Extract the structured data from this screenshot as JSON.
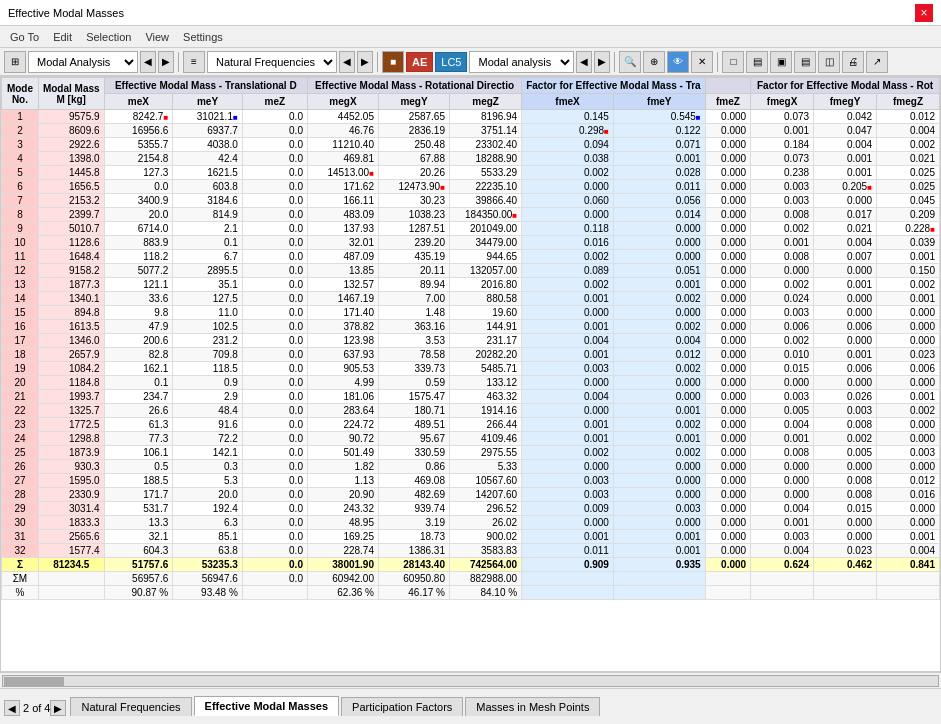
{
  "titleBar": {
    "title": "Effective Modal Masses",
    "closeLabel": "×"
  },
  "menuBar": {
    "items": [
      "Go To",
      "Edit",
      "Selection",
      "View",
      "Settings"
    ]
  },
  "toolbar1": {
    "modalAnalysis": "Modal Analysis",
    "naturalFrequencies": "Natural Frequencies",
    "ae": "AE",
    "lc5": "LC5",
    "modalAnalysisDropdown": "Modal analysis"
  },
  "tableHeaders": {
    "modeNo": "Mode No.",
    "modalMass": "Modal Mass M [kg]",
    "translational": "Effective Modal Mass - Translational D",
    "me_x": "meX",
    "me_y": "meY",
    "me_z": "meZ",
    "rotational": "Effective Modal Mass - Rotational Directi",
    "meg_x": "megX",
    "meg_y": "megY",
    "meg_z": "megZ",
    "factorTrans": "Factor for Effective Modal Mass - Tra",
    "fme_x": "fmeX",
    "fme_y": "fmeY",
    "factorRot": "Factor for Effective Modal Mass - Rot",
    "fme_z": "fmeZ",
    "fmeg_x": "fmegX",
    "fmeg_y": "fmegY",
    "fmeg_z": "fmegZ"
  },
  "rows": [
    {
      "mode": "1",
      "mass": "9575.9",
      "mex": "8242.7",
      "mey": "31021.1",
      "mez": "0.0",
      "megx": "4452.05",
      "megy": "2587.65",
      "megz": "8196.94",
      "fmex": "0.145",
      "fmey": "0.545",
      "fmez": "0.000",
      "fmegx": "0.073",
      "fmegy": "0.042",
      "fmegz": "0.012"
    },
    {
      "mode": "2",
      "mass": "8609.6",
      "mex": "16956.6",
      "mey": "6937.7",
      "mez": "0.0",
      "megx": "46.76",
      "megy": "2836.19",
      "megz": "3751.14",
      "fmex": "0.298",
      "fmey": "0.122",
      "fmez": "0.000",
      "fmegx": "0.001",
      "fmegy": "0.047",
      "fmegz": "0.004"
    },
    {
      "mode": "3",
      "mass": "2922.6",
      "mex": "5355.7",
      "mey": "4038.0",
      "mez": "0.0",
      "megx": "11210.40",
      "megy": "250.48",
      "megz": "23302.40",
      "fmex": "0.094",
      "fmey": "0.071",
      "fmez": "0.000",
      "fmegx": "0.184",
      "fmegy": "0.004",
      "fmegz": "0.002"
    },
    {
      "mode": "4",
      "mass": "1398.0",
      "mex": "2154.8",
      "mey": "42.4",
      "mez": "0.0",
      "megx": "469.81",
      "megy": "67.88",
      "megz": "18288.90",
      "fmex": "0.038",
      "fmey": "0.001",
      "fmez": "0.000",
      "fmegx": "0.073",
      "fmegy": "0.001",
      "fmegz": "0.021"
    },
    {
      "mode": "5",
      "mass": "1445.8",
      "mex": "127.3",
      "mey": "1621.5",
      "mez": "0.0",
      "megx": "14513.00",
      "megy": "20.26",
      "megz": "5533.29",
      "fmex": "0.002",
      "fmey": "0.028",
      "fmez": "0.000",
      "fmegx": "0.238",
      "fmegy": "0.001",
      "fmegz": "0.025"
    },
    {
      "mode": "6",
      "mass": "1656.5",
      "mex": "0.0",
      "mey": "603.8",
      "mez": "0.0",
      "megx": "171.62",
      "megy": "12473.90",
      "megz": "22235.10",
      "fmex": "0.000",
      "fmey": "0.011",
      "fmez": "0.000",
      "fmegx": "0.003",
      "fmegy": "0.205",
      "fmegz": "0.025"
    },
    {
      "mode": "7",
      "mass": "2153.2",
      "mex": "3400.9",
      "mey": "3184.6",
      "mez": "0.0",
      "megx": "166.11",
      "megy": "30.23",
      "megz": "39866.40",
      "fmex": "0.060",
      "fmey": "0.056",
      "fmez": "0.000",
      "fmegx": "0.003",
      "fmegy": "0.000",
      "fmegz": "0.045"
    },
    {
      "mode": "8",
      "mass": "2399.7",
      "mex": "20.0",
      "mey": "814.9",
      "mez": "0.0",
      "megx": "483.09",
      "megy": "1038.23",
      "megz": "184350.00",
      "fmex": "0.000",
      "fmey": "0.014",
      "fmez": "0.000",
      "fmegx": "0.008",
      "fmegy": "0.017",
      "fmegz": "0.209"
    },
    {
      "mode": "9",
      "mass": "5010.7",
      "mex": "6714.0",
      "mey": "2.1",
      "mez": "0.0",
      "megx": "137.93",
      "megy": "1287.51",
      "megz": "201049.00",
      "fmex": "0.118",
      "fmey": "0.000",
      "fmez": "0.000",
      "fmegx": "0.002",
      "fmegy": "0.021",
      "fmegz": "0.228"
    },
    {
      "mode": "10",
      "mass": "1128.6",
      "mex": "883.9",
      "mey": "0.1",
      "mez": "0.0",
      "megx": "32.01",
      "megy": "239.20",
      "megz": "34479.00",
      "fmex": "0.016",
      "fmey": "0.000",
      "fmez": "0.000",
      "fmegx": "0.001",
      "fmegy": "0.004",
      "fmegz": "0.039"
    },
    {
      "mode": "11",
      "mass": "1648.4",
      "mex": "118.2",
      "mey": "6.7",
      "mez": "0.0",
      "megx": "487.09",
      "megy": "435.19",
      "megz": "944.65",
      "fmex": "0.002",
      "fmey": "0.000",
      "fmez": "0.000",
      "fmegx": "0.008",
      "fmegy": "0.007",
      "fmegz": "0.001"
    },
    {
      "mode": "12",
      "mass": "9158.2",
      "mex": "5077.2",
      "mey": "2895.5",
      "mez": "0.0",
      "megx": "13.85",
      "megy": "20.11",
      "megz": "132057.00",
      "fmex": "0.089",
      "fmey": "0.051",
      "fmez": "0.000",
      "fmegx": "0.000",
      "fmegy": "0.000",
      "fmegz": "0.150"
    },
    {
      "mode": "13",
      "mass": "1877.3",
      "mex": "121.1",
      "mey": "35.1",
      "mez": "0.0",
      "megx": "132.57",
      "megy": "89.94",
      "megz": "2016.80",
      "fmex": "0.002",
      "fmey": "0.001",
      "fmez": "0.000",
      "fmegx": "0.002",
      "fmegy": "0.001",
      "fmegz": "0.002"
    },
    {
      "mode": "14",
      "mass": "1340.1",
      "mex": "33.6",
      "mey": "127.5",
      "mez": "0.0",
      "megx": "1467.19",
      "megy": "7.00",
      "megz": "880.58",
      "fmex": "0.001",
      "fmey": "0.002",
      "fmez": "0.000",
      "fmegx": "0.024",
      "fmegy": "0.000",
      "fmegz": "0.001"
    },
    {
      "mode": "15",
      "mass": "894.8",
      "mex": "9.8",
      "mey": "11.0",
      "mez": "0.0",
      "megx": "171.40",
      "megy": "1.48",
      "megz": "19.60",
      "fmex": "0.000",
      "fmey": "0.000",
      "fmez": "0.000",
      "fmegx": "0.003",
      "fmegy": "0.000",
      "fmegz": "0.000"
    },
    {
      "mode": "16",
      "mass": "1613.5",
      "mex": "47.9",
      "mey": "102.5",
      "mez": "0.0",
      "megx": "378.82",
      "megy": "363.16",
      "megz": "144.91",
      "fmex": "0.001",
      "fmey": "0.002",
      "fmez": "0.000",
      "fmegx": "0.006",
      "fmegy": "0.006",
      "fmegz": "0.000"
    },
    {
      "mode": "17",
      "mass": "1346.0",
      "mex": "200.6",
      "mey": "231.2",
      "mez": "0.0",
      "megx": "123.98",
      "megy": "3.53",
      "megz": "231.17",
      "fmex": "0.004",
      "fmey": "0.004",
      "fmez": "0.000",
      "fmegx": "0.002",
      "fmegy": "0.000",
      "fmegz": "0.000"
    },
    {
      "mode": "18",
      "mass": "2657.9",
      "mex": "82.8",
      "mey": "709.8",
      "mez": "0.0",
      "megx": "637.93",
      "megy": "78.58",
      "megz": "20282.20",
      "fmex": "0.001",
      "fmey": "0.012",
      "fmez": "0.000",
      "fmegx": "0.010",
      "fmegy": "0.001",
      "fmegz": "0.023"
    },
    {
      "mode": "19",
      "mass": "1084.2",
      "mex": "162.1",
      "mey": "118.5",
      "mez": "0.0",
      "megx": "905.53",
      "megy": "339.73",
      "megz": "5485.71",
      "fmex": "0.003",
      "fmey": "0.002",
      "fmez": "0.000",
      "fmegx": "0.015",
      "fmegy": "0.006",
      "fmegz": "0.006"
    },
    {
      "mode": "20",
      "mass": "1184.8",
      "mex": "0.1",
      "mey": "0.9",
      "mez": "0.0",
      "megx": "4.99",
      "megy": "0.59",
      "megz": "133.12",
      "fmex": "0.000",
      "fmey": "0.000",
      "fmez": "0.000",
      "fmegx": "0.000",
      "fmegy": "0.000",
      "fmegz": "0.000"
    },
    {
      "mode": "21",
      "mass": "1993.7",
      "mex": "234.7",
      "mey": "2.9",
      "mez": "0.0",
      "megx": "181.06",
      "megy": "1575.47",
      "megz": "463.32",
      "fmex": "0.004",
      "fmey": "0.000",
      "fmez": "0.000",
      "fmegx": "0.003",
      "fmegy": "0.026",
      "fmegz": "0.001"
    },
    {
      "mode": "22",
      "mass": "1325.7",
      "mex": "26.6",
      "mey": "48.4",
      "mez": "0.0",
      "megx": "283.64",
      "megy": "180.71",
      "megz": "1914.16",
      "fmex": "0.000",
      "fmey": "0.001",
      "fmez": "0.000",
      "fmegx": "0.005",
      "fmegy": "0.003",
      "fmegz": "0.002"
    },
    {
      "mode": "23",
      "mass": "1772.5",
      "mex": "61.3",
      "mey": "91.6",
      "mez": "0.0",
      "megx": "224.72",
      "megy": "489.51",
      "megz": "266.44",
      "fmex": "0.001",
      "fmey": "0.002",
      "fmez": "0.000",
      "fmegx": "0.004",
      "fmegy": "0.008",
      "fmegz": "0.000"
    },
    {
      "mode": "24",
      "mass": "1298.8",
      "mex": "77.3",
      "mey": "72.2",
      "mez": "0.0",
      "megx": "90.72",
      "megy": "95.67",
      "megz": "4109.46",
      "fmex": "0.001",
      "fmey": "0.001",
      "fmez": "0.000",
      "fmegx": "0.001",
      "fmegy": "0.002",
      "fmegz": "0.000"
    },
    {
      "mode": "25",
      "mass": "1873.9",
      "mex": "106.1",
      "mey": "142.1",
      "mez": "0.0",
      "megx": "501.49",
      "megy": "330.59",
      "megz": "2975.55",
      "fmex": "0.002",
      "fmey": "0.002",
      "fmez": "0.000",
      "fmegx": "0.008",
      "fmegy": "0.005",
      "fmegz": "0.003"
    },
    {
      "mode": "26",
      "mass": "930.3",
      "mex": "0.5",
      "mey": "0.3",
      "mez": "0.0",
      "megx": "1.82",
      "megy": "0.86",
      "megz": "5.33",
      "fmex": "0.000",
      "fmey": "0.000",
      "fmez": "0.000",
      "fmegx": "0.000",
      "fmegy": "0.000",
      "fmegz": "0.000"
    },
    {
      "mode": "27",
      "mass": "1595.0",
      "mex": "188.5",
      "mey": "5.3",
      "mez": "0.0",
      "megx": "1.13",
      "megy": "469.08",
      "megz": "10567.60",
      "fmex": "0.003",
      "fmey": "0.000",
      "fmez": "0.000",
      "fmegx": "0.000",
      "fmegy": "0.008",
      "fmegz": "0.012"
    },
    {
      "mode": "28",
      "mass": "2330.9",
      "mex": "171.7",
      "mey": "20.0",
      "mez": "0.0",
      "megx": "20.90",
      "megy": "482.69",
      "megz": "14207.60",
      "fmex": "0.003",
      "fmey": "0.000",
      "fmez": "0.000",
      "fmegx": "0.000",
      "fmegy": "0.008",
      "fmegz": "0.016"
    },
    {
      "mode": "29",
      "mass": "3031.4",
      "mex": "531.7",
      "mey": "192.4",
      "mez": "0.0",
      "megx": "243.32",
      "megy": "939.74",
      "megz": "296.52",
      "fmex": "0.009",
      "fmey": "0.003",
      "fmez": "0.000",
      "fmegx": "0.004",
      "fmegy": "0.015",
      "fmegz": "0.000"
    },
    {
      "mode": "30",
      "mass": "1833.3",
      "mex": "13.3",
      "mey": "6.3",
      "mez": "0.0",
      "megx": "48.95",
      "megy": "3.19",
      "megz": "26.02",
      "fmex": "0.000",
      "fmey": "0.000",
      "fmez": "0.000",
      "fmegx": "0.001",
      "fmegy": "0.000",
      "fmegz": "0.000"
    },
    {
      "mode": "31",
      "mass": "2565.6",
      "mex": "32.1",
      "mey": "85.1",
      "mez": "0.0",
      "megx": "169.25",
      "megy": "18.73",
      "megz": "900.02",
      "fmex": "0.001",
      "fmey": "0.001",
      "fmez": "0.000",
      "fmegx": "0.003",
      "fmegy": "0.000",
      "fmegz": "0.001"
    },
    {
      "mode": "32",
      "mass": "1577.4",
      "mex": "604.3",
      "mey": "63.8",
      "mez": "0.0",
      "megx": "228.74",
      "megy": "1386.31",
      "megz": "3583.83",
      "fmex": "0.011",
      "fmey": "0.001",
      "fmez": "0.000",
      "fmegx": "0.004",
      "fmegy": "0.023",
      "fmegz": "0.004"
    }
  ],
  "sumRow": {
    "label": "Σ",
    "mass": "81234.5",
    "mex": "51757.6",
    "mey": "53235.3",
    "mez": "0.0",
    "megx": "38001.90",
    "megy": "28143.40",
    "megz": "742564.00",
    "fmex": "0.909",
    "fmey": "0.935",
    "fmez": "0.000",
    "fmegx": "0.624",
    "fmegy": "0.462",
    "fmegz": "0.841"
  },
  "sumMRow": {
    "label": "ΣM",
    "mex": "56957.6",
    "mey": "56947.6",
    "mez": "0.0",
    "megx": "60942.00",
    "megy": "60950.80",
    "megz": "882988.00"
  },
  "percentRow": {
    "label": "%",
    "mex": "90.87 %",
    "mey": "93.48 %",
    "mez": "",
    "megx": "62.36 %",
    "megy": "46.17 %",
    "megz": "84.10 %"
  },
  "tabs": [
    {
      "label": "Natural Frequencies",
      "active": false
    },
    {
      "label": "Effective Modal Masses",
      "active": true
    },
    {
      "label": "Participation Factors",
      "active": false
    },
    {
      "label": "Masses in Mesh Points",
      "active": false
    }
  ],
  "pageInfo": {
    "current": "2",
    "total": "of 4"
  }
}
